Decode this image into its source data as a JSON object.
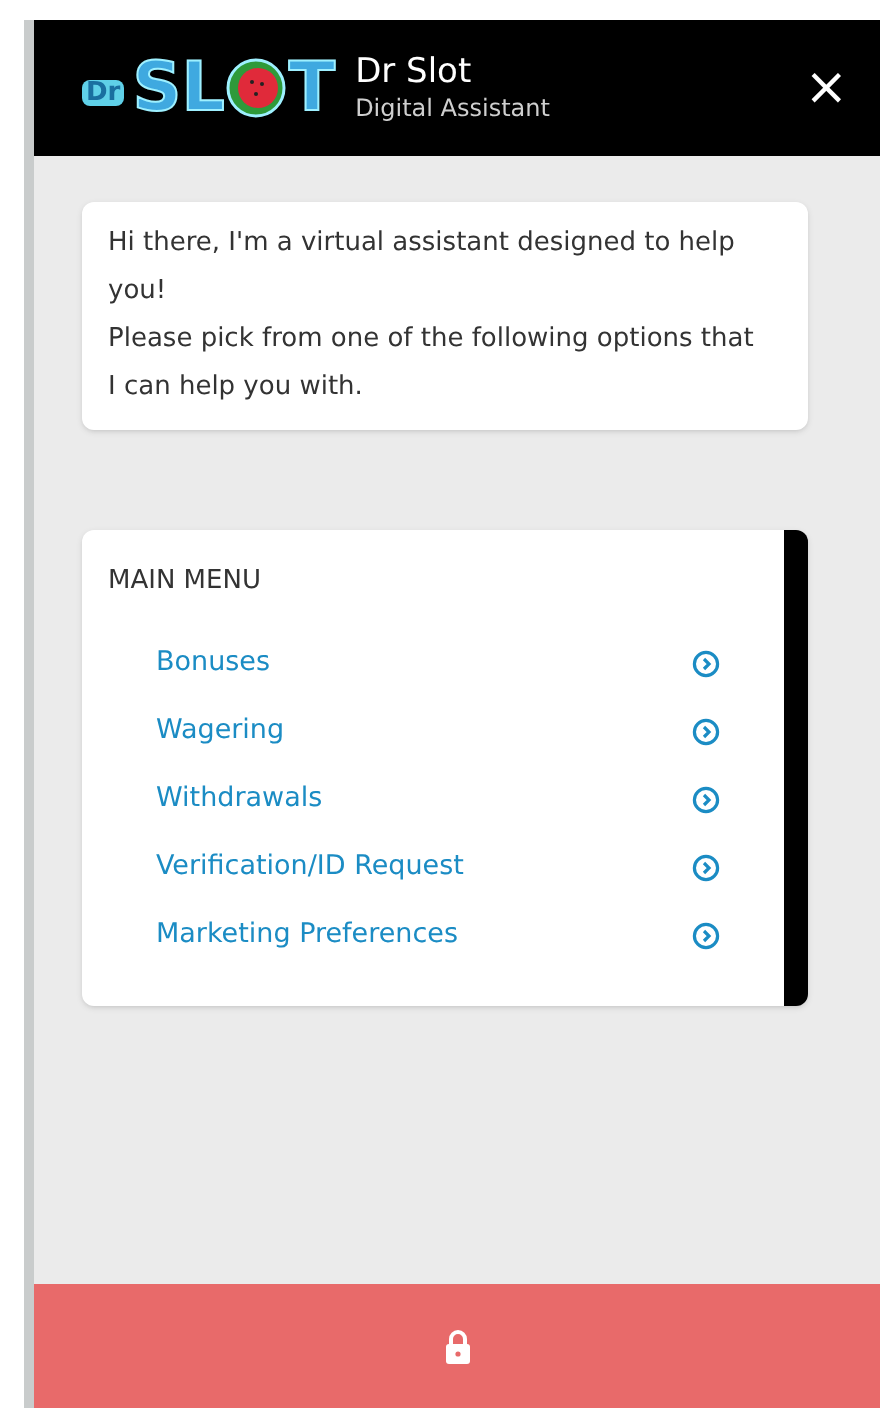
{
  "header": {
    "logo": {
      "prefix": "Dr",
      "word_start": "SL",
      "word_end": "T"
    },
    "title": "Dr Slot",
    "subtitle": "Digital Assistant",
    "close": "×"
  },
  "message": {
    "lines": [
      "Hi there, I'm a virtual assistant designed to help you!",
      "Please pick from one of the following options that I can help you with."
    ]
  },
  "menu": {
    "title": "MAIN MENU",
    "items": [
      {
        "label": "Bonuses"
      },
      {
        "label": "Wagering"
      },
      {
        "label": "Withdrawals"
      },
      {
        "label": "Verification/ID Request"
      },
      {
        "label": "Marketing Preferences"
      }
    ]
  },
  "footer": {
    "locked": true
  }
}
